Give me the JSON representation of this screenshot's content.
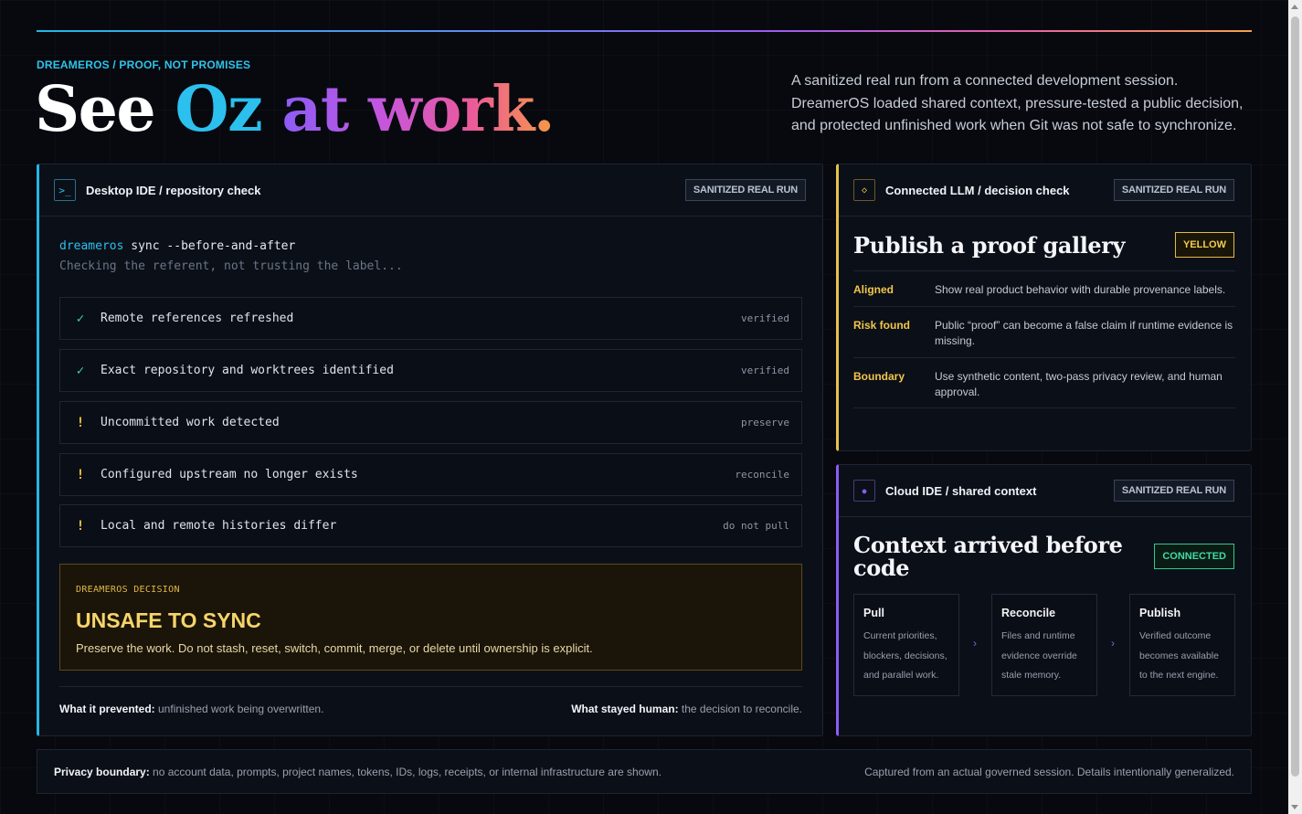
{
  "header": {
    "eyebrow": "DREAMEROS / PROOF, NOT PROMISES",
    "hero_w1": "See",
    "hero_w2": "Oz",
    "hero_w3": "at work.",
    "intro": "A sanitized real run from a connected development session. DreamerOS loaded shared context, pressure-tested a public decision, and protected unfinished work when Git was not safe to synchronize."
  },
  "repo_panel": {
    "icon": "terminal-icon",
    "icon_glyph": ">_",
    "title": "Desktop IDE / repository check",
    "badge": "SANITIZED REAL RUN",
    "cmd_prog": "dreameros",
    "cmd_args": " sync --before-and-after",
    "cmd_sub": "Checking the referent, not trusting the label...",
    "checks": [
      {
        "mark": "✓",
        "kind": "ok",
        "label": "Remote references refreshed",
        "status": "verified"
      },
      {
        "mark": "✓",
        "kind": "ok",
        "label": "Exact repository and worktrees identified",
        "status": "verified"
      },
      {
        "mark": "!",
        "kind": "warn",
        "label": "Uncommitted work detected",
        "status": "preserve"
      },
      {
        "mark": "!",
        "kind": "warn",
        "label": "Configured upstream no longer exists",
        "status": "reconcile"
      },
      {
        "mark": "!",
        "kind": "warn",
        "label": "Local and remote histories differ",
        "status": "do not pull"
      }
    ],
    "decision_kicker": "DREAMEROS DECISION",
    "decision_title": "UNSAFE TO SYNC",
    "decision_desc": "Preserve the work. Do not stash, reset, switch, commit, merge, or delete until ownership is explicit.",
    "prevented_label": "What it prevented:",
    "prevented_value": " unfinished work being overwritten.",
    "human_label": "What stayed human:",
    "human_value": " the decision to reconcile."
  },
  "llm_panel": {
    "icon": "diamond-icon",
    "icon_glyph": "◇",
    "title": "Connected LLM / decision check",
    "badge": "SANITIZED REAL RUN",
    "heading": "Publish a proof gallery",
    "pill": "YELLOW",
    "rows": [
      {
        "key": "Aligned",
        "value": "Show real product behavior with durable provenance labels."
      },
      {
        "key": "Risk found",
        "value": "Public “proof” can become a false claim if runtime evidence is missing."
      },
      {
        "key": "Boundary",
        "value": "Use synthetic content, two-pass privacy review, and human approval."
      }
    ]
  },
  "cloud_panel": {
    "icon": "info-circle-icon",
    "icon_glyph": "●",
    "title": "Cloud IDE / shared context",
    "badge": "SANITIZED REAL RUN",
    "heading": "Context arrived before code",
    "pill": "CONNECTED",
    "steps": [
      {
        "title": "Pull",
        "desc": "Current priorities, blockers, decisions, and parallel work."
      },
      {
        "title": "Reconcile",
        "desc": "Files and runtime evidence override stale memory."
      },
      {
        "title": "Publish",
        "desc": "Verified outcome becomes available to the next engine."
      }
    ],
    "arrow_glyph": "›"
  },
  "footer": {
    "privacy_label": "Privacy boundary:",
    "privacy_value": " no account data, prompts, project names, tokens, IDs, logs, receipts, or internal infrastructure are shown.",
    "captured": "Captured from an actual governed session. Details intentionally generalized."
  },
  "colors": {
    "accent_cyan": "#2cc0ee",
    "accent_yellow": "#f1c64a",
    "accent_purple": "#8b5cf6",
    "accent_green": "#3fdca2"
  }
}
